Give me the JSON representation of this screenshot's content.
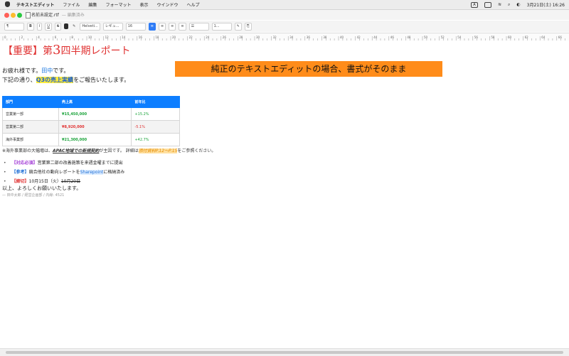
{
  "menubar": {
    "app_name": "テキストエディット",
    "items": [
      "ファイル",
      "編集",
      "フォーマット",
      "表示",
      "ウインドウ",
      "ヘルプ"
    ],
    "input_indicator": "A",
    "datetime": "3月21日(土) 16:26"
  },
  "window": {
    "title": "名前未設定.rtf",
    "edited_label": "— 編集済み"
  },
  "toolbar": {
    "paragraph_style": "¶",
    "bold": "B",
    "italic": "I",
    "underline": "U",
    "strike": "S",
    "font_family": "Helveti...",
    "font_style": "レギュ...",
    "font_size": "16",
    "list_style": "1...",
    "colors": {
      "text_swatch": "#2c2c2c",
      "active": "#2f7cf6"
    }
  },
  "ruler": {
    "labels": [
      "0",
      "2",
      "4",
      "6",
      "8",
      "10",
      "12",
      "14",
      "16",
      "18",
      "20",
      "22",
      "24",
      "26",
      "28",
      "30",
      "32",
      "34",
      "36",
      "38",
      "40",
      "42",
      "44",
      "46",
      "48",
      "50",
      "52",
      "54",
      "56",
      "58",
      "60",
      "62",
      "64",
      "66"
    ]
  },
  "document": {
    "heading": {
      "bracket": "【重要】第",
      "digit": "3",
      "rest": "四半期レポート"
    },
    "greeting": {
      "prefix": "お疲れ様です。",
      "name": "田中",
      "suffix": "です。"
    },
    "intro": {
      "prefix": "下記の通り、",
      "highlight": "Q3の売上実績",
      "suffix": "をご報告いたします。"
    },
    "banner": "純正のテキストエディットの場合、書式がそのまま",
    "table": {
      "headers": [
        "部門",
        "売上高",
        "前年比"
      ],
      "rows": [
        {
          "dept": "営業第一部",
          "sales": "¥15,450,000",
          "yoy": "+15.2%",
          "sales_color": "#1aa33a",
          "yoy_color": "#1aa33a"
        },
        {
          "dept": "営業第二部",
          "sales": "¥8,920,000",
          "yoy": "-5.1%",
          "sales_color": "#e03131",
          "yoy_color": "#e03131"
        },
        {
          "dept": "海外事業部",
          "sales": "¥21,300,000",
          "yoy": "+42.7%",
          "sales_color": "#1aa33a",
          "yoy_color": "#1aa33a"
        }
      ]
    },
    "note": {
      "prefix": "※海外事業部の大幅増は、",
      "underlined": "APAC地域での新規契約",
      "middle": "が主因です。 詳細は",
      "highlighted": "添付資料P.12〜P.15",
      "suffix": "をご参照ください。"
    },
    "bullets": [
      {
        "tag": "【対応必須】",
        "text": "営業第二部の改善施策を来週金曜までに提出"
      },
      {
        "tag": "【参考】",
        "text_before": "競合他社の動向レポートを",
        "link": "Sharepoint",
        "text_after": "に格納済み"
      },
      {
        "tag": "【締切】",
        "text": "10月15日（火）",
        "struck": "10月20日"
      }
    ],
    "closing": "以上、よろしくお願いいたします。",
    "signature": "— 田中太郎 / 経営企画部 / 内線: 4521"
  }
}
